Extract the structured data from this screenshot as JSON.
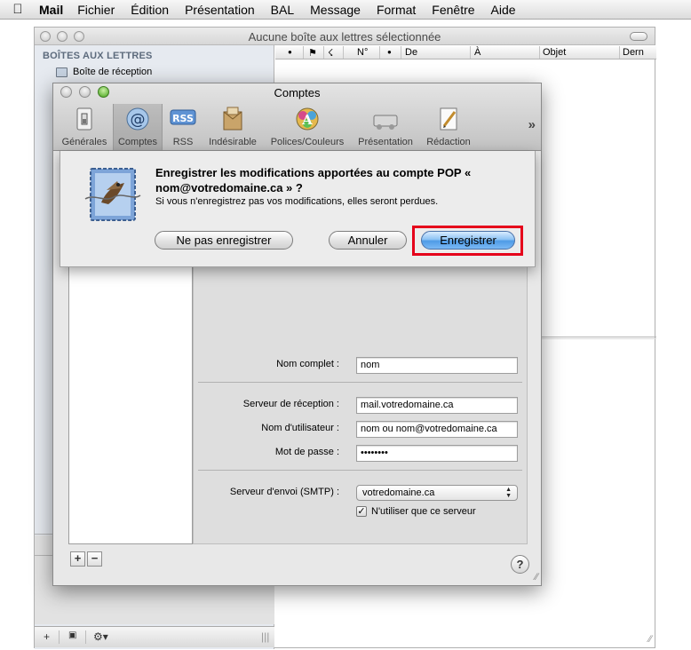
{
  "menubar": {
    "app": "Mail",
    "items": [
      "Fichier",
      "Édition",
      "Présentation",
      "BAL",
      "Message",
      "Format",
      "Fenêtre",
      "Aide"
    ]
  },
  "mail_window": {
    "title": "Aucune boîte aux lettres sélectionnée",
    "sidebar_header": "BOÎTES AUX LETTRES",
    "inbox_label": "Boîte de réception",
    "columns": [
      "●",
      "⚑",
      "☇",
      "N°",
      "●",
      "De",
      "À",
      "Objet",
      "Dern"
    ]
  },
  "prefs": {
    "title": "Comptes",
    "toolbar": [
      {
        "label": "Générales",
        "icon": "switch-icon"
      },
      {
        "label": "Comptes",
        "icon": "at-sign-icon"
      },
      {
        "label": "RSS",
        "icon": "rss-icon"
      },
      {
        "label": "Indésirable",
        "icon": "junk-mail-icon"
      },
      {
        "label": "Polices/Couleurs",
        "icon": "font-color-icon"
      },
      {
        "label": "Présentation",
        "icon": "viewing-icon"
      },
      {
        "label": "Rédaction",
        "icon": "composing-icon"
      }
    ],
    "fields": {
      "full_name_label": "Nom complet :",
      "full_name_value": "nom",
      "incoming_label": "Serveur de réception :",
      "incoming_value": "mail.votredomaine.ca",
      "user_label": "Nom d'utilisateur :",
      "user_value": "nom ou nom@votredomaine.ca",
      "password_label": "Mot de passe :",
      "password_value": "••••••••",
      "smtp_label": "Serveur d'envoi (SMTP) :",
      "smtp_value": "votredomaine.ca",
      "only_server_label": "N'utiliser que ce serveur"
    },
    "add_label": "+",
    "remove_label": "−",
    "help_label": "?"
  },
  "sheet": {
    "title": "Enregistrer les modifications apportées au compte POP « nom@votredomaine.ca » ?",
    "message": "Si vous n'enregistrez pas vos modifications, elles seront perdues.",
    "dont_save": "Ne pas enregistrer",
    "cancel": "Annuler",
    "save": "Enregistrer"
  },
  "colors": {
    "highlight_box": "#e5001a",
    "default_button": "#4f9be6"
  }
}
